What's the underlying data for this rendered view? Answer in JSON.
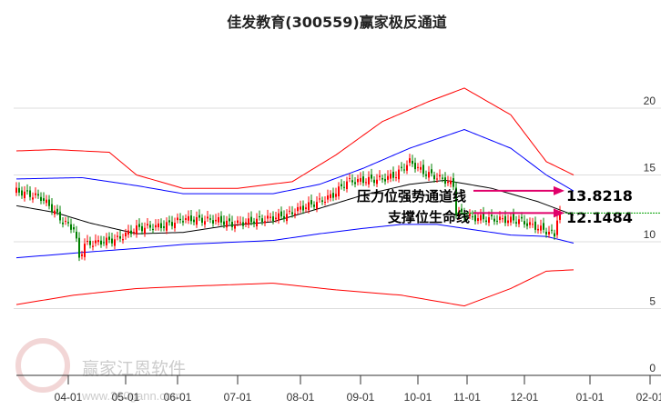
{
  "chart_data": {
    "type": "line",
    "title": "佳发教育(300559)赢家极反通道",
    "x_unit": "trading-day index",
    "ylim": [
      0,
      22
    ],
    "y_ticks": [
      0,
      5,
      10,
      15,
      20
    ],
    "x_ticks": [
      {
        "label": "04-01",
        "x": 20
      },
      {
        "label": "05-01",
        "x": 41
      },
      {
        "label": "06-01",
        "x": 60
      },
      {
        "label": "07-01",
        "x": 82
      },
      {
        "label": "08-01",
        "x": 105
      },
      {
        "label": "09-01",
        "x": 127
      },
      {
        "label": "10-01",
        "x": 148
      },
      {
        "label": "11-01",
        "x": 166
      },
      {
        "label": "12-01",
        "x": 187
      },
      {
        "label": "01-01",
        "x": 211
      },
      {
        "label": "02-01",
        "x": 233
      }
    ],
    "series": [
      {
        "name": "outer-upper",
        "color": "#ff0000",
        "points": [
          [
            1,
            16.8
          ],
          [
            15,
            16.9
          ],
          [
            35,
            16.7
          ],
          [
            45,
            15
          ],
          [
            62,
            14
          ],
          [
            82,
            14
          ],
          [
            102,
            14.5
          ],
          [
            118,
            16.5
          ],
          [
            135,
            19
          ],
          [
            152,
            20.5
          ],
          [
            165,
            21.5
          ],
          [
            182,
            19.5
          ],
          [
            195,
            16
          ],
          [
            205,
            15
          ]
        ]
      },
      {
        "name": "inner-upper",
        "color": "#0000ff",
        "points": [
          [
            1,
            14.7
          ],
          [
            25,
            14.8
          ],
          [
            45,
            14.2
          ],
          [
            62,
            13.6
          ],
          [
            95,
            13.6
          ],
          [
            112,
            14.3
          ],
          [
            128,
            15.5
          ],
          [
            145,
            17
          ],
          [
            165,
            18.4
          ],
          [
            182,
            17
          ],
          [
            195,
            15
          ],
          [
            205,
            13.8
          ]
        ]
      },
      {
        "name": "middle",
        "color": "#000000",
        "points": [
          [
            1,
            12.7
          ],
          [
            15,
            12.2
          ],
          [
            28,
            11.4
          ],
          [
            45,
            10.6
          ],
          [
            62,
            10.7
          ],
          [
            78,
            11.2
          ],
          [
            95,
            11.5
          ],
          [
            112,
            12.5
          ],
          [
            128,
            13.5
          ],
          [
            145,
            14.3
          ],
          [
            158,
            14.6
          ],
          [
            175,
            14
          ],
          [
            192,
            13
          ],
          [
            205,
            12
          ]
        ]
      },
      {
        "name": "inner-lower",
        "color": "#0000ff",
        "points": [
          [
            1,
            8.8
          ],
          [
            25,
            9.2
          ],
          [
            45,
            9.5
          ],
          [
            62,
            9.8
          ],
          [
            95,
            10.1
          ],
          [
            112,
            10.6
          ],
          [
            128,
            11
          ],
          [
            142,
            11.3
          ],
          [
            155,
            11.3
          ],
          [
            165,
            11
          ],
          [
            182,
            10.5
          ],
          [
            195,
            10.4
          ],
          [
            205,
            9.9
          ]
        ]
      },
      {
        "name": "outer-lower",
        "color": "#ff0000",
        "points": [
          [
            1,
            5.3
          ],
          [
            22,
            6
          ],
          [
            45,
            6.5
          ],
          [
            68,
            6.7
          ],
          [
            95,
            6.9
          ],
          [
            118,
            6.4
          ],
          [
            142,
            6
          ],
          [
            162,
            5.3
          ],
          [
            165,
            5.2
          ],
          [
            182,
            6.5
          ],
          [
            195,
            7.8
          ],
          [
            205,
            7.9
          ]
        ]
      }
    ],
    "price_close_keypoints": [
      [
        1,
        13.8
      ],
      [
        10,
        13.3
      ],
      [
        14,
        12.5
      ],
      [
        18,
        11.5
      ],
      [
        22,
        11
      ],
      [
        23,
        10
      ],
      [
        24,
        8.8
      ],
      [
        26,
        9.8
      ],
      [
        38,
        10.2
      ],
      [
        45,
        11
      ],
      [
        55,
        11.2
      ],
      [
        62,
        11.7
      ],
      [
        75,
        11.6
      ],
      [
        80,
        11.3
      ],
      [
        95,
        11.8
      ],
      [
        100,
        12
      ],
      [
        105,
        12.5
      ],
      [
        112,
        13
      ],
      [
        117,
        13.5
      ],
      [
        122,
        14.5
      ],
      [
        135,
        14.7
      ],
      [
        140,
        15
      ],
      [
        145,
        16
      ],
      [
        150,
        15.2
      ],
      [
        158,
        14.6
      ],
      [
        161,
        14.2
      ],
      [
        162,
        12.2
      ],
      [
        168,
        11.8
      ],
      [
        175,
        11.7
      ],
      [
        185,
        11.6
      ],
      [
        190,
        11.2
      ],
      [
        195,
        10.8
      ],
      [
        198,
        10.5
      ],
      [
        199,
        11.8
      ],
      [
        200,
        12.1
      ]
    ],
    "annotations": {
      "resistance_label": "压力位强势通道线",
      "resistance_value": "13.8218",
      "resistance_level": 13.8218,
      "support_label": "支撑位生命线",
      "support_value": "12.1484",
      "support_level": 12.1484
    },
    "colors": {
      "up": "#ff0000",
      "down": "#008000",
      "arrow": "#e0006a",
      "support_line": "#00a000"
    }
  },
  "watermark": {
    "name": "赢家江恩软件",
    "url": "www.360gann.com",
    "seal": "江赢恩家"
  }
}
